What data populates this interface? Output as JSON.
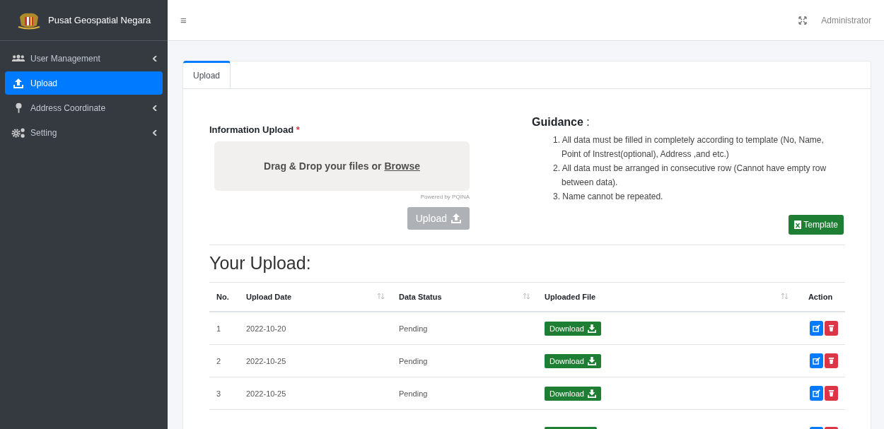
{
  "brand": {
    "title": "Pusat Geospatial Negara"
  },
  "sidebar": {
    "items": [
      {
        "label": "User Management",
        "selected": false,
        "has_submenu": true
      },
      {
        "label": "Upload",
        "selected": true,
        "has_submenu": false
      },
      {
        "label": "Address Coordinate",
        "selected": false,
        "has_submenu": true
      },
      {
        "label": "Setting",
        "selected": false,
        "has_submenu": true
      }
    ]
  },
  "header": {
    "menu_icon": "≡",
    "user": "Administrator"
  },
  "tabs": [
    {
      "label": "Upload",
      "selected": true
    }
  ],
  "upload_form": {
    "label": "Information Upload",
    "required_mark": "*",
    "drop_text": "Drag & Drop your files or ",
    "browse_link": "Browse",
    "powered_by": "Powered by PQINA",
    "button": {
      "label": "Upload",
      "disabled": true
    }
  },
  "guidance": {
    "title": "Guidance",
    "colon": ":",
    "items": [
      "1. All data must be filled in completely according to template (No, Name, Point of Instrest(optional), Address ,and etc.)",
      "2. All data must be arranged in consecutive row (Cannot have empty row between data).",
      "3. Name cannot be repeated."
    ],
    "template_button": "Template"
  },
  "uploads": {
    "title": "Your Upload:",
    "columns": [
      {
        "label": "No.",
        "sortable": false
      },
      {
        "label": "Upload Date",
        "sortable": true
      },
      {
        "label": "Data Status",
        "sortable": true
      },
      {
        "label": "Uploaded File",
        "sortable": true
      },
      {
        "label": "Action",
        "sortable": false
      }
    ],
    "rows": [
      {
        "kind": "full",
        "no": "1",
        "date": "2022-10-20",
        "status": "Pending",
        "download": "Download"
      },
      {
        "kind": "full",
        "no": "2",
        "date": "2022-10-25",
        "status": "Pending",
        "download": "Download"
      },
      {
        "kind": "full",
        "no": "3",
        "date": "2022-10-25",
        "status": "Pending",
        "download": "Download"
      },
      {
        "kind": "cut"
      }
    ]
  }
}
